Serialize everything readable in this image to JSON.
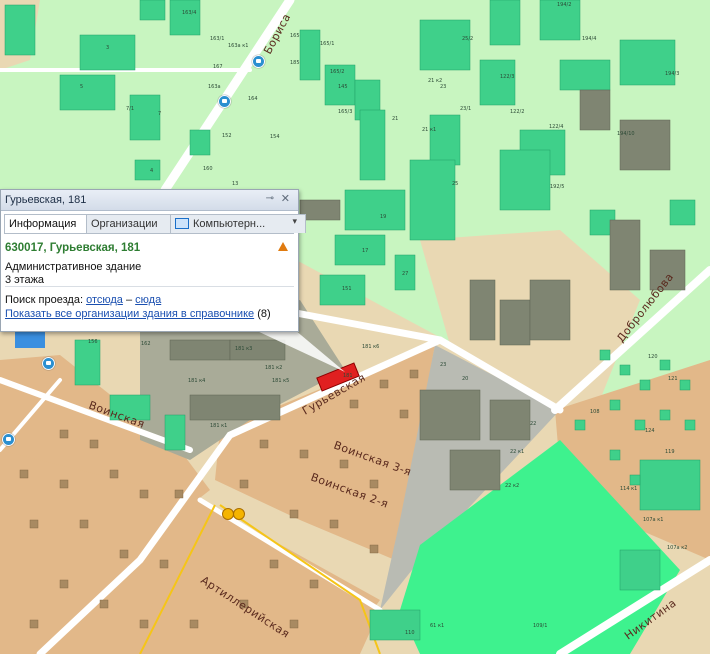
{
  "map": {
    "colors": {
      "background": "#e9d8b3",
      "green_area": "#c8f5c0",
      "residential": "#e2b889",
      "industrial": "#a9ab98",
      "building": "#3fd08a",
      "park": "#3ef28e",
      "road": "#ffffff",
      "selected_building": "#e02020"
    },
    "streets": [
      "Бориса",
      "Гурьевская",
      "Воинская",
      "Воинская 3-я",
      "Воинская 2-я",
      "Артиллерийская",
      "Добролюбова",
      "Никитина"
    ],
    "building_labels": [
      "163/4",
      "165",
      "163/1",
      "163а",
      "163а к1",
      "167",
      "185",
      "165/1",
      "165/2",
      "164",
      "154",
      "152",
      "160",
      "7",
      "4",
      "3",
      "5",
      "7/1",
      "13",
      "150",
      "144",
      "145",
      "19",
      "17",
      "27",
      "21",
      "25",
      "25/2",
      "23",
      "23/1",
      "21 к2",
      "21 к1",
      "122/3",
      "122/2",
      "122/4",
      "192/5",
      "194/3",
      "194/2",
      "194/4",
      "194/10",
      "181 к1",
      "181 к2",
      "181 к3",
      "181 к4",
      "181 к5",
      "181 к6",
      "181",
      "156",
      "162",
      "165/3",
      "151",
      "20",
      "22",
      "23",
      "22 к1",
      "22 к2",
      "114 к1",
      "107а к1",
      "107а к2",
      "109/1",
      "61 к1",
      "110",
      "120",
      "121",
      "108",
      "124",
      "119"
    ]
  },
  "popup": {
    "title": "Гурьевская, 181",
    "tabs": [
      "Информация",
      "Организации",
      "Компьютерн..."
    ],
    "address": "630017, Гурьевская, 181",
    "building_type": "Административное здание",
    "floors": "3 этажа",
    "route_label": "Поиск проезда:",
    "route_from": "отсюда",
    "route_dash": "–",
    "route_to": "сюда",
    "show_all_link": "Показать все организации здания в справочнике",
    "org_count": "(8)"
  }
}
